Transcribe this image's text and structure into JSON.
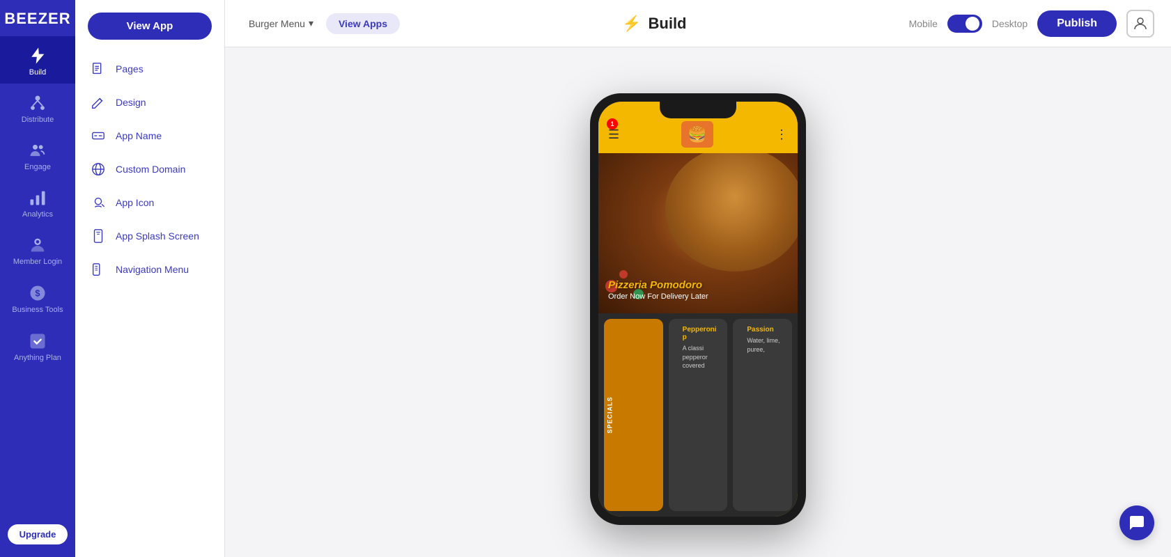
{
  "logo": {
    "text": "BEEZER"
  },
  "sidebar": {
    "items": [
      {
        "id": "build",
        "label": "Build",
        "active": true,
        "icon": "lightning"
      },
      {
        "id": "distribute",
        "label": "Distribute",
        "active": false,
        "icon": "distribute"
      },
      {
        "id": "engage",
        "label": "Engage",
        "active": false,
        "icon": "engage"
      },
      {
        "id": "analytics",
        "label": "Analytics",
        "active": false,
        "icon": "analytics"
      },
      {
        "id": "member-login",
        "label": "Member Login",
        "active": false,
        "icon": "member"
      },
      {
        "id": "business-tools",
        "label": "Business Tools",
        "active": false,
        "icon": "business"
      },
      {
        "id": "anything-plan",
        "label": "Anything Plan",
        "active": false,
        "icon": "plan"
      }
    ],
    "upgrade_label": "Upgrade"
  },
  "panel": {
    "view_app_button": "View App",
    "items": [
      {
        "id": "pages",
        "label": "Pages",
        "icon": "pages"
      },
      {
        "id": "design",
        "label": "Design",
        "icon": "design"
      },
      {
        "id": "app-name",
        "label": "App Name",
        "icon": "app-name"
      },
      {
        "id": "custom-domain",
        "label": "Custom Domain",
        "icon": "custom-domain"
      },
      {
        "id": "app-icon",
        "label": "App Icon",
        "icon": "app-icon"
      },
      {
        "id": "app-splash-screen",
        "label": "App Splash Screen",
        "icon": "splash"
      },
      {
        "id": "navigation-menu",
        "label": "Navigation Menu",
        "icon": "nav-menu"
      }
    ]
  },
  "topbar": {
    "burger_menu_label": "Burger Menu",
    "view_apps_label": "View Apps",
    "build_label": "Build",
    "mobile_label": "Mobile",
    "desktop_label": "Desktop",
    "publish_label": "Publish"
  },
  "phone": {
    "app_title": "Pizzeria Pomodoro",
    "app_subtitle": "Order Now For Delivery Later",
    "notification_count": "1",
    "card1_name": "Pepperoni p",
    "card1_desc": "A classi pepperor covered",
    "card2_name": "Passion",
    "card2_desc": "Water, lime, puree,",
    "specials_label": "specials"
  },
  "chat": {
    "icon": "chat-icon"
  }
}
